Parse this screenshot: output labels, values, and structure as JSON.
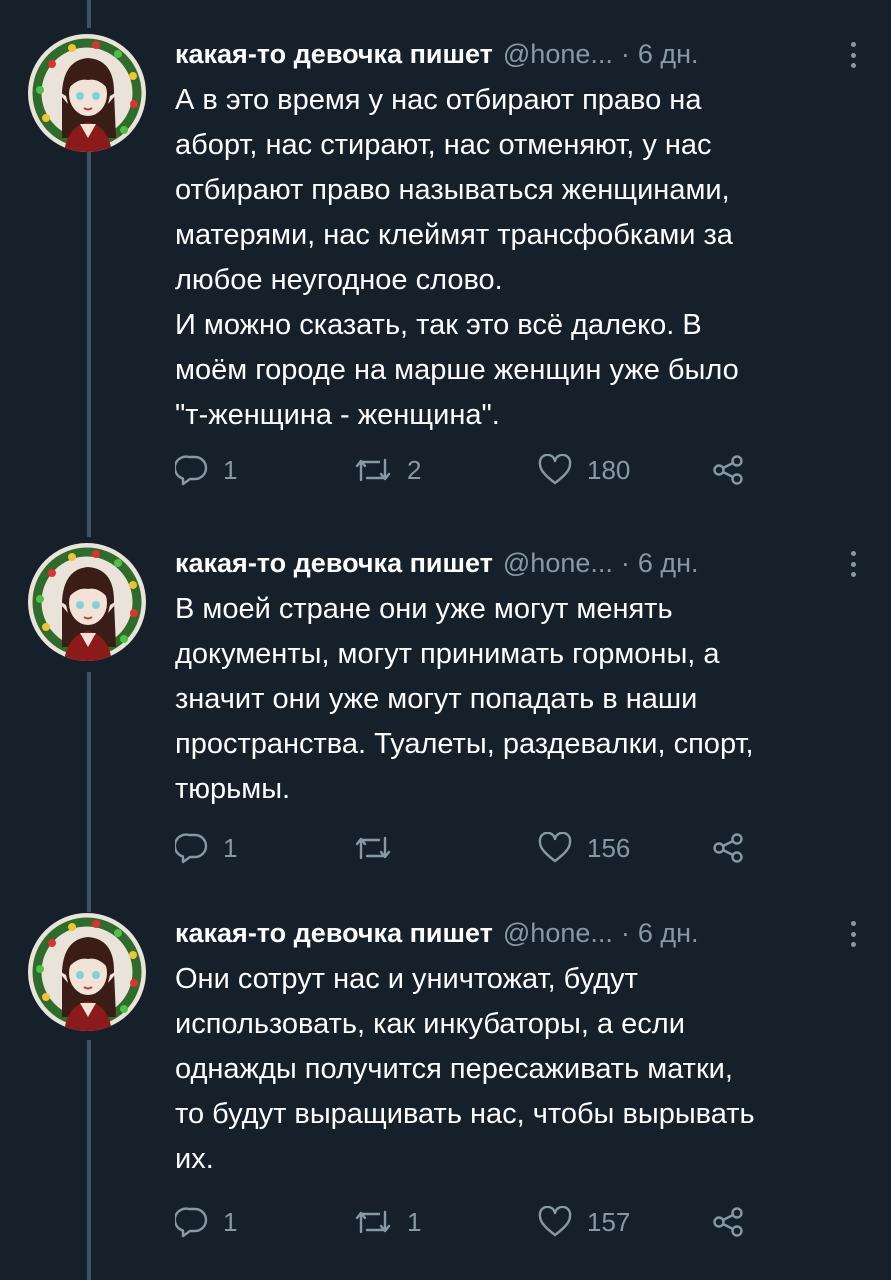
{
  "colors": {
    "background": "#15202b",
    "text": "#ffffff",
    "secondary": "#8899a6",
    "thread_line": "#3d5466"
  },
  "tweets": [
    {
      "author_name": "какая-то девочка пишет",
      "handle": "@hone...",
      "dot": "·",
      "time": "6 дн.",
      "text": "А в это время у нас отбирают право на\nаборт, нас стирают, нас отменяют, у нас\nотбирают право называться женщинами,\nматерями, нас клеймят трансфобками за\nлюбое неугодное слово.\nИ можно сказать, так это всё далеко. В\nмоём городе на марше женщин уже было\n\"т-женщина - женщина\".",
      "replies": "1",
      "retweets": "2",
      "likes": "180",
      "icons": [
        "reply-icon",
        "retweet-icon",
        "like-icon",
        "share-icon"
      ]
    },
    {
      "author_name": "какая-то девочка пишет",
      "handle": "@hone...",
      "dot": "·",
      "time": "6 дн.",
      "text": "В моей стране они уже могут менять\nдокументы, могут принимать гормоны, а\nзначит они уже могут попадать в наши\nпространства. Туалеты, раздевалки, спорт,\nтюрьмы.",
      "replies": "1",
      "retweets": "",
      "likes": "156",
      "icons": [
        "reply-icon",
        "retweet-icon",
        "like-icon",
        "share-icon"
      ]
    },
    {
      "author_name": "какая-то девочка пишет",
      "handle": "@hone...",
      "dot": "·",
      "time": "6 дн.",
      "text": "Они сотрут нас и уничтожат, будут\nиспользовать, как инкубаторы, а если\nоднажды получится пересаживать матки,\nто будут выращивать нас, чтобы вырывать\nих.",
      "replies": "1",
      "retweets": "1",
      "likes": "157",
      "icons": [
        "reply-icon",
        "retweet-icon",
        "like-icon",
        "share-icon"
      ]
    }
  ]
}
